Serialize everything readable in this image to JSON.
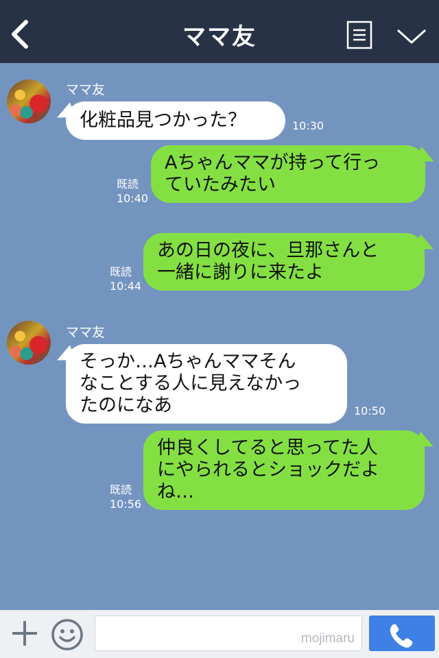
{
  "header": {
    "title": "ママ友"
  },
  "messages": [
    {
      "sender": "ママ友",
      "lines": [
        "化粧品見つかった？"
      ],
      "time": "10:30"
    },
    {
      "lines": [
        "Aちゃんママが持って行っ",
        "ていたみたい"
      ],
      "read": "既読",
      "time": "10:40"
    },
    {
      "lines": [
        "あの日の夜に、旦那さんと",
        "一緒に謝りに来たよ"
      ],
      "read": "既読",
      "time": "10:44"
    },
    {
      "sender": "ママ友",
      "lines": [
        "そっか…Aちゃんママそん",
        "なことする人に見えなかっ",
        "たのになあ"
      ],
      "time": "10:50"
    },
    {
      "lines": [
        "仲良くしてると思ってた人",
        "にやられるとショックだよ",
        "ね…"
      ],
      "read": "既読",
      "time": "10:56"
    }
  ],
  "footer": {
    "watermark": "mojimaru"
  },
  "colors": {
    "header_bg": "#273246",
    "chat_bg": "#7494c0",
    "incoming": "#ffffff",
    "outgoing": "#84e042",
    "call": "#3f80e5"
  },
  "icons": [
    "back-arrow-icon",
    "menu-icon",
    "chevron-down-icon",
    "plus-icon",
    "emoji-icon",
    "phone-icon"
  ]
}
